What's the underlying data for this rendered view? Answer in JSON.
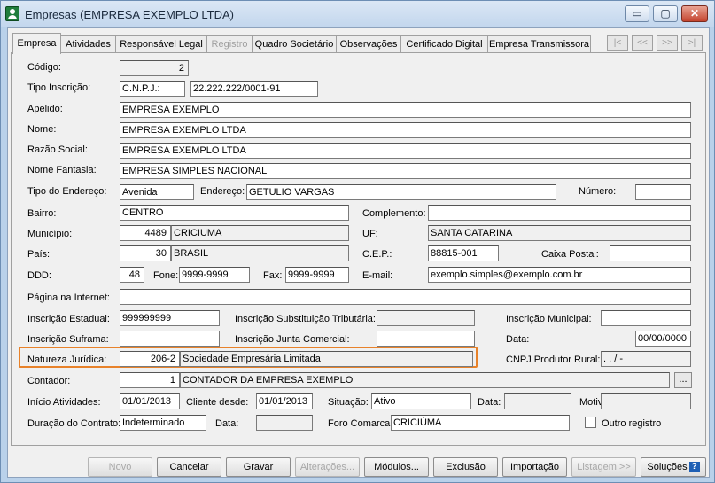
{
  "window": {
    "title": "Empresas (EMPRESA EXEMPLO LTDA)",
    "min": "▭",
    "max": "▢",
    "close": "✕"
  },
  "tabs": [
    {
      "label": "Empresa"
    },
    {
      "label": "Atividades"
    },
    {
      "label": "Responsável Legal"
    },
    {
      "label": "Registro"
    },
    {
      "label": "Quadro Societário"
    },
    {
      "label": "Observações"
    },
    {
      "label": "Certificado Digital"
    },
    {
      "label": "Empresa Transmissora"
    }
  ],
  "nav": {
    "first": "|<",
    "prev": "<<",
    "next": ">>",
    "last": ">|"
  },
  "labels": {
    "codigo": "Código:",
    "tipo_inscricao": "Tipo Inscrição:",
    "apelido": "Apelido:",
    "nome": "Nome:",
    "razao_social": "Razão Social:",
    "nome_fantasia": "Nome Fantasia:",
    "tipo_endereco": "Tipo do Endereço:",
    "endereco": "Endereço:",
    "numero": "Número:",
    "bairro": "Bairro:",
    "complemento": "Complemento:",
    "municipio": "Município:",
    "uf": "UF:",
    "pais": "País:",
    "cep": "C.E.P.:",
    "caixa_postal": "Caixa Postal:",
    "ddd": "DDD:",
    "fone": "Fone:",
    "fax": "Fax:",
    "email": "E-mail:",
    "pagina": "Página na Internet:",
    "insc_estadual": "Inscrição Estadual:",
    "insc_subst": "Inscrição Substituição Tributária:",
    "insc_municipal": "Inscrição Municipal:",
    "insc_suframa": "Inscrição Suframa:",
    "insc_junta": "Inscrição Junta Comercial:",
    "data": "Data:",
    "natureza": "Natureza Jurídica:",
    "cnpj_produtor": "CNPJ Produtor Rural:",
    "contador": "Contador:",
    "inicio": "Início Atividades:",
    "cliente_desde": "Cliente desde:",
    "situacao": "Situação:",
    "data2": "Data:",
    "motivo": "Motivo:",
    "duracao": "Duração do Contrato:",
    "data3": "Data:",
    "foro": "Foro Comarca:",
    "outro_registro": "Outro registro"
  },
  "values": {
    "codigo": "2",
    "tipo_inscricao": "C.N.P.J.:",
    "cnpj": "22.222.222/0001-91",
    "apelido": "EMPRESA EXEMPLO",
    "nome": "EMPRESA EXEMPLO LTDA",
    "razao_social": "EMPRESA EXEMPLO LTDA",
    "nome_fantasia": "EMPRESA SIMPLES NACIONAL",
    "tipo_endereco": "Avenida",
    "endereco": "GETULIO VARGAS",
    "numero": "",
    "bairro": "CENTRO",
    "complemento": "",
    "municipio_cod": "4489",
    "municipio": "CRICIUMA",
    "uf": "SANTA CATARINA",
    "pais_cod": "30",
    "pais": "BRASIL",
    "cep": "88815-001",
    "caixa_postal": "",
    "ddd": "48",
    "fone": "9999-9999",
    "fax": "9999-9999",
    "email": "exemplo.simples@exemplo.com.br",
    "pagina": "",
    "insc_estadual": "999999999",
    "insc_subst": "",
    "insc_municipal": "",
    "insc_suframa": "",
    "insc_junta": "",
    "data": "00/00/0000",
    "natureza_cod": "206-2",
    "natureza": "Sociedade Empresária Limitada",
    "cnpj_produtor": ". . / -",
    "contador_cod": "1",
    "contador": "CONTADOR DA EMPRESA EXEMPLO",
    "inicio": "01/01/2013",
    "cliente_desde": "01/01/2013",
    "situacao": "Ativo",
    "data2": "",
    "motivo": "",
    "duracao": "Indeterminado",
    "data3": "",
    "foro": "CRICIÚMA",
    "dots": "..."
  },
  "buttons": {
    "novo": "Novo",
    "cancelar": "Cancelar",
    "gravar": "Gravar",
    "alteracoes": "Alterações...",
    "modulos": "Módulos...",
    "exclusao": "Exclusão",
    "importacao": "Importação",
    "listagem": "Listagem >>",
    "solucoes": "Soluções",
    "help": "?"
  },
  "colors": {
    "highlight": "#e8822a",
    "window_border": "#6d8eb4"
  }
}
